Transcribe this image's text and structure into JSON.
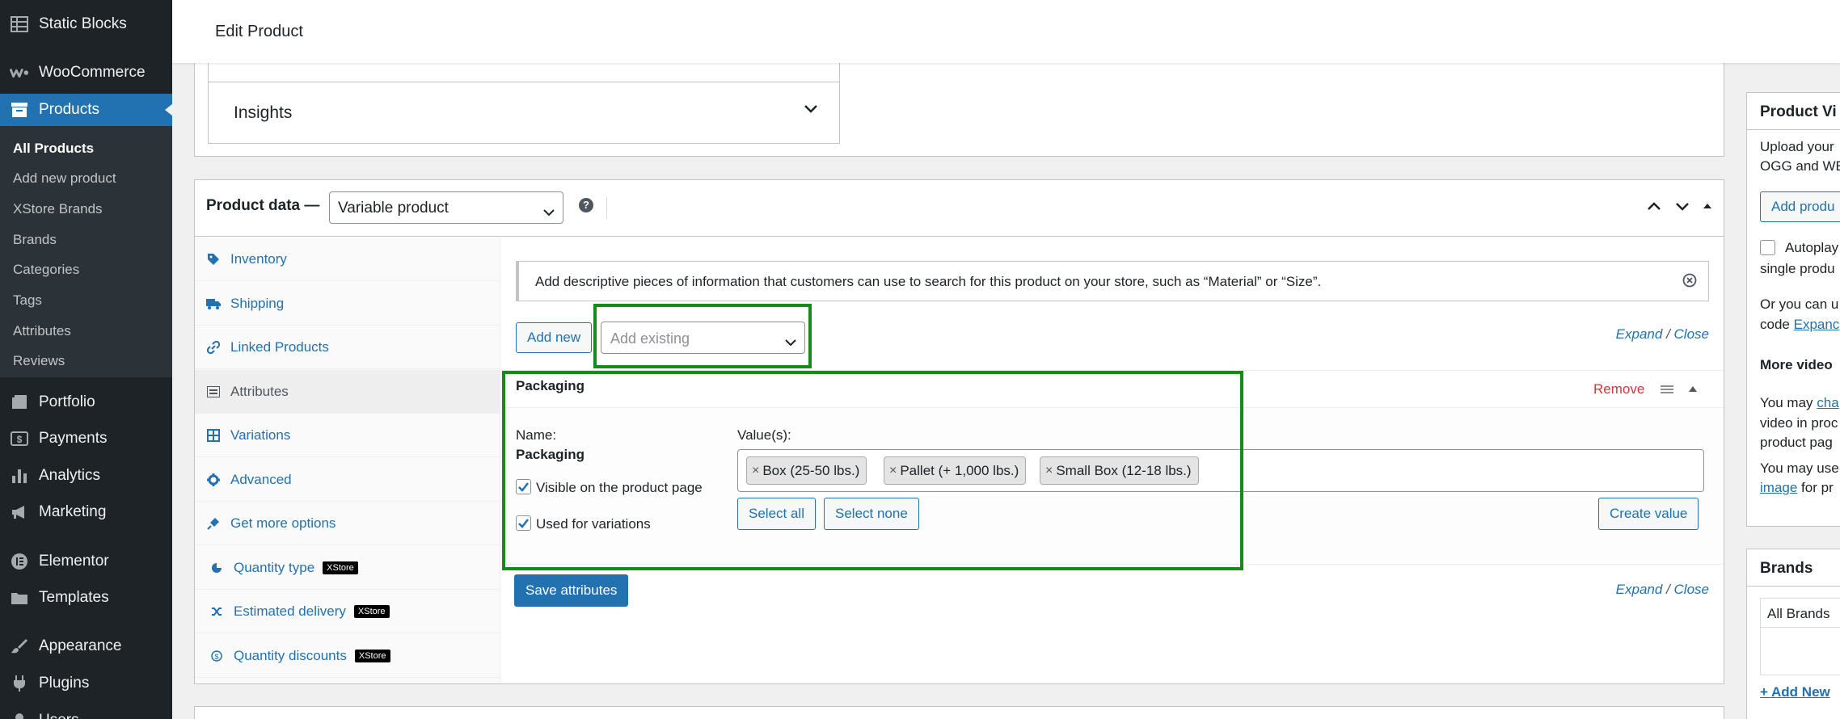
{
  "sidebar": {
    "items": [
      {
        "label": "Static Blocks",
        "icon": "table-icon"
      },
      {
        "label": "WooCommerce",
        "icon": "woo-icon"
      },
      {
        "label": "Products",
        "icon": "archive-icon"
      },
      {
        "label": "Portfolio",
        "icon": "portfolio-icon"
      },
      {
        "label": "Payments",
        "icon": "payments-icon"
      },
      {
        "label": "Analytics",
        "icon": "bar-chart-icon"
      },
      {
        "label": "Marketing",
        "icon": "megaphone-icon"
      },
      {
        "label": "Elementor",
        "icon": "elementor-icon"
      },
      {
        "label": "Templates",
        "icon": "folder-icon"
      },
      {
        "label": "Appearance",
        "icon": "brush-icon"
      },
      {
        "label": "Plugins",
        "icon": "plug-icon"
      },
      {
        "label": "Users",
        "icon": "user-icon"
      }
    ],
    "submenu": [
      "All Products",
      "Add new product",
      "XStore Brands",
      "Brands",
      "Categories",
      "Tags",
      "Attributes",
      "Reviews"
    ]
  },
  "header": {
    "title": "Edit Product"
  },
  "insights": {
    "label": "Insights"
  },
  "product_data": {
    "title": "Product data —",
    "type": "Variable product",
    "help": "?",
    "tabs": [
      {
        "label": "Inventory",
        "icon": "tag-icon"
      },
      {
        "label": "Shipping",
        "icon": "truck-icon"
      },
      {
        "label": "Linked Products",
        "icon": "link-icon"
      },
      {
        "label": "Attributes",
        "icon": "list-icon"
      },
      {
        "label": "Variations",
        "icon": "grid-icon"
      },
      {
        "label": "Advanced",
        "icon": "gear-icon"
      },
      {
        "label": "Get more options",
        "icon": "plugin-icon"
      },
      {
        "label": "Quantity type",
        "icon": "pie-icon",
        "badge": "XStore"
      },
      {
        "label": "Estimated delivery",
        "icon": "shuffle-icon",
        "badge": "XStore"
      },
      {
        "label": "Quantity discounts",
        "icon": "dollar-icon",
        "badge": "XStore"
      }
    ]
  },
  "attributes": {
    "notice": "Add descriptive pieces of information that customers can use to search for this product on your store, such as “Material” or “Size”.",
    "add_new": "Add new",
    "add_existing_placeholder": "Add existing",
    "expand": "Expand",
    "slash": "/",
    "close": "Close",
    "attribute": {
      "heading": "Packaging",
      "remove": "Remove",
      "name_label": "Name:",
      "name_value": "Packaging",
      "values_label": "Value(s):",
      "values": [
        "Box (25-50 lbs.)",
        "Pallet (+ 1,000 lbs.)",
        "Small Box (12-18 lbs.)"
      ],
      "chip_remove": "×",
      "visible_label": "Visible on the product page",
      "variations_label": "Used for variations",
      "select_all": "Select all",
      "select_none": "Select none",
      "create_value": "Create value"
    },
    "save": "Save attributes"
  },
  "right_column": {
    "video_title": "Product Vi",
    "video_text1": "Upload your",
    "video_text2": "OGG and WE",
    "add_button": "Add produ",
    "autoplay_label": "Autoplay",
    "autoplay_text2": "single produ",
    "or_text": "Or you can u",
    "code_text": "code",
    "expand_link": "Expanc",
    "more_video": "More video",
    "may_text": "You may",
    "cha_link": "cha",
    "video_in": "video in proc",
    "product_pag": "product pag",
    "may_use": "You may use",
    "image_link": "image",
    "for_pr": "for pr",
    "brands_title": "Brands",
    "all_brands_tab": "All Brands",
    "add_new_brand": "+ Add New"
  },
  "colors": {
    "accent": "#2271b1",
    "highlight": "#168b1a",
    "remove": "#d63638"
  }
}
